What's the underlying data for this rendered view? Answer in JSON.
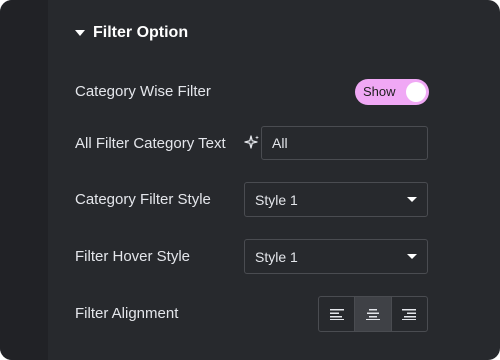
{
  "section": {
    "title": "Filter Option",
    "expanded": true
  },
  "fields": {
    "category_wise_filter": {
      "label": "Category Wise Filter",
      "toggle_label": "Show",
      "enabled": true
    },
    "all_filter_category_text": {
      "label": "All Filter Category Text",
      "value": "All",
      "icon": "ai-sparkle-icon"
    },
    "category_filter_style": {
      "label": "Category Filter Style",
      "selected": "Style 1"
    },
    "filter_hover_style": {
      "label": "Filter Hover Style",
      "selected": "Style 1"
    },
    "filter_alignment": {
      "label": "Filter Alignment",
      "options": [
        "align-left-icon",
        "align-center-icon",
        "align-right-icon"
      ],
      "active": "align-center-icon"
    }
  },
  "colors": {
    "panel_bg": "#27292d",
    "toggle_bg": "#f0a8f5",
    "border": "#4a4c51"
  }
}
